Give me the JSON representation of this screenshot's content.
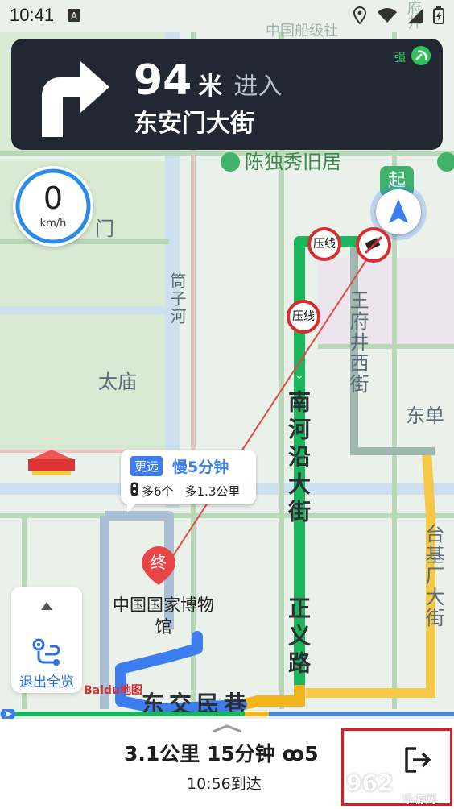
{
  "status_bar": {
    "time": "10:41",
    "icons": [
      "notification-a-icon",
      "location-icon",
      "wifi-icon",
      "battery-icon"
    ]
  },
  "guidance": {
    "turn_icon": "turn-right-arrow-icon",
    "distance_value": "94",
    "distance_unit": "米",
    "action": "进入",
    "road_name": "东安门大街",
    "signal_label": "强"
  },
  "speedometer": {
    "value": "0",
    "unit": "km/h"
  },
  "map_labels": {
    "poi_chen": "陈独秀旧居",
    "east_gate": "门",
    "tongzi": "筒子河",
    "taimiao": "太庙",
    "museum": "中国国家博物馆",
    "nanhe": "南河沿大街",
    "zhengyi": "正义路",
    "wangfujing": "王府井西街",
    "taiji": "台基厂大街",
    "dongdan": "东单",
    "dongjiaomin": "东交民巷",
    "top_street": "中国船级社",
    "top_fu": "府井",
    "start_marker": "起",
    "end_marker": "终",
    "pressure_line": "压线"
  },
  "route_bubble": {
    "tag": "更远",
    "time": "慢5分钟",
    "lights": "多6个",
    "distance": "多1.3公里"
  },
  "left_panel": {
    "up_icon": "triangle-up-icon",
    "exit_label": "退出全览",
    "exit_icon": "route-overview-icon"
  },
  "bottom": {
    "summary": "3.1公里 15分钟 ꝏ5",
    "arrival": "10:56到达",
    "quit_icon": "exit-navigation-icon"
  },
  "branding": {
    "baidu": "Baidu地图",
    "watermark": "962",
    "watermark_sub": "乐游网"
  },
  "colors": {
    "route_green": "#1bb55c",
    "route_blue": "#3d7df2",
    "card_bg": "#212833",
    "highlight_border": "#d91e1e"
  }
}
